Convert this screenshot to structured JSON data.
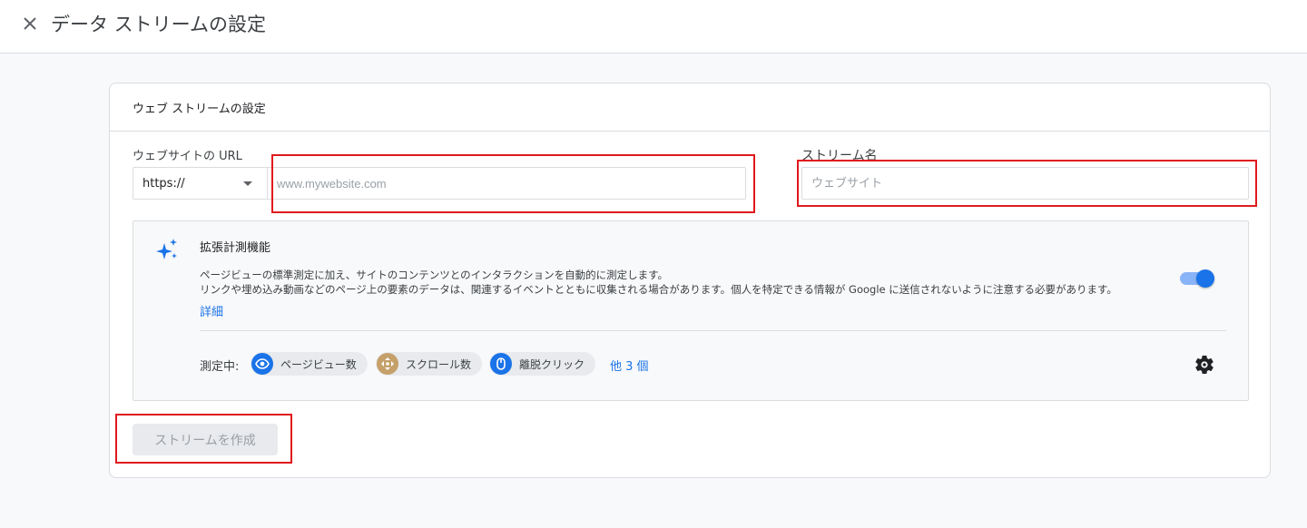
{
  "header": {
    "title": "データ ストリームの設定",
    "close_icon": "close-icon"
  },
  "card": {
    "title": "ウェブ ストリームの設定",
    "url": {
      "label": "ウェブサイトの URL",
      "protocol": "https://",
      "value": "",
      "placeholder": "www.mywebsite.com"
    },
    "stream_name": {
      "label": "ストリーム名",
      "value": "",
      "placeholder": "ウェブサイト"
    },
    "enhanced": {
      "title": "拡張計測機能",
      "description_line1": "ページビューの標準測定に加え、サイトのコンテンツとのインタラクションを自動的に測定します。",
      "description_line2": "リンクや埋め込み動画などのページ上の要素のデータは、関連するイベントとともに収集される場合があります。個人を特定できる情報が Google に送信されないように注意する必要があります。",
      "details_link": "詳細",
      "toggle_on": true,
      "measuring_label": "測定中:",
      "chips": [
        {
          "label": "ページビュー数",
          "icon": "eye-icon",
          "color": "#1a73e8"
        },
        {
          "label": "スクロール数",
          "icon": "scroll-icon",
          "color": "#c5a06a"
        },
        {
          "label": "離脱クリック",
          "icon": "mouse-icon",
          "color": "#1a73e8"
        }
      ],
      "more_link": "他 3 個",
      "settings_icon": "gear-icon"
    },
    "create_button": "ストリームを作成"
  },
  "colors": {
    "accent": "#1a73e8",
    "highlight_box": "#e0191d"
  }
}
